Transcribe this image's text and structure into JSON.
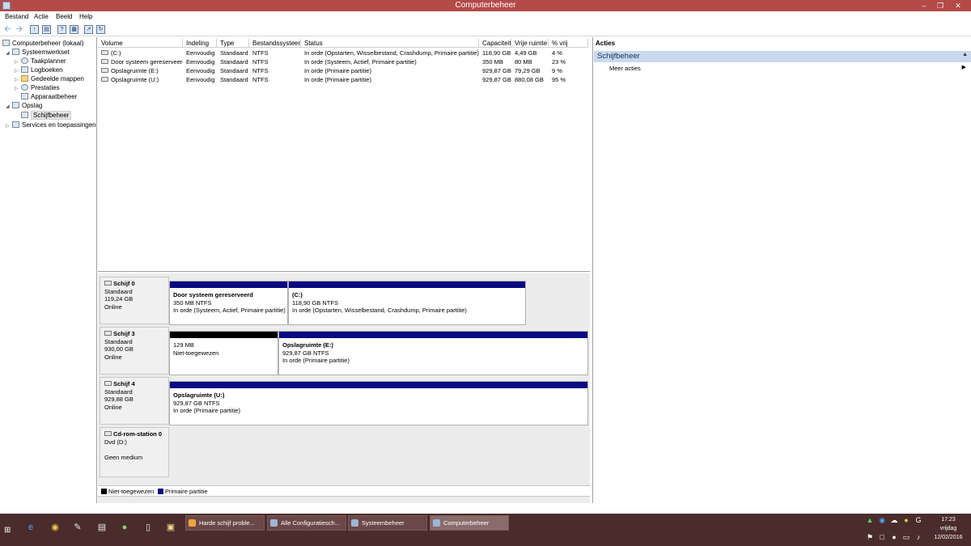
{
  "window": {
    "title": "Computerbeheer",
    "min_icon": "minimize-icon",
    "restore_icon": "restore-icon",
    "close_icon": "close-icon"
  },
  "menu": [
    "Bestand",
    "Actie",
    "Beeld",
    "Help"
  ],
  "toolbar": {
    "icons": [
      "back-arrow-icon",
      "forward-arrow-icon",
      "up-folder-icon",
      "show-hide-tree-icon",
      "help-icon",
      "properties-icon",
      "export-icon",
      "refresh-icon"
    ]
  },
  "tree": [
    {
      "label": "Computerbeheer (lokaal)",
      "level": 0,
      "expanded": null,
      "icon": "computer-management-icon"
    },
    {
      "label": "Systeemwerkset",
      "level": 1,
      "expanded": true,
      "icon": "system-tools-icon"
    },
    {
      "label": "Taakplanner",
      "level": 2,
      "expanded": false,
      "icon": "task-scheduler-icon"
    },
    {
      "label": "Logboeken",
      "level": 2,
      "expanded": false,
      "icon": "event-viewer-icon"
    },
    {
      "label": "Gedeelde mappen",
      "level": 2,
      "expanded": false,
      "icon": "shared-folders-icon"
    },
    {
      "label": "Prestaties",
      "level": 2,
      "expanded": false,
      "icon": "performance-icon"
    },
    {
      "label": "Apparaatbeheer",
      "level": 2,
      "expanded": null,
      "icon": "device-manager-icon"
    },
    {
      "label": "Opslag",
      "level": 1,
      "expanded": true,
      "icon": "storage-icon"
    },
    {
      "label": "Schijfbeheer",
      "level": 2,
      "expanded": null,
      "icon": "disk-management-icon",
      "selected": true
    },
    {
      "label": "Services en toepassingen",
      "level": 1,
      "expanded": false,
      "icon": "services-icon"
    }
  ],
  "volumes": {
    "columns": [
      "Volume",
      "Indeling",
      "Type",
      "Bestandssysteem",
      "Status",
      "Capaciteit",
      "Vrije ruimte",
      "% vrij"
    ],
    "rows": [
      [
        "(C:)",
        "Eenvoudig",
        "Standaard",
        "NTFS",
        "In orde (Opstarten, Wisselbestand, Crashdump, Primaire partitie)",
        "118,90 GB",
        "4,49 GB",
        "4 %"
      ],
      [
        "Door systeem gereserveerd",
        "Eenvoudig",
        "Standaard",
        "NTFS",
        "In orde (Systeem, Actief, Primaire partitie)",
        "350 MB",
        "80 MB",
        "23 %"
      ],
      [
        "Opslagruimte (E:)",
        "Eenvoudig",
        "Standaard",
        "NTFS",
        "In orde (Primaire partitie)",
        "929,87 GB",
        "79,29 GB",
        "9 %"
      ],
      [
        "Opslagruimte (U:)",
        "Eenvoudig",
        "Standaard",
        "NTFS",
        "In orde (Primaire partitie)",
        "929,87 GB",
        "880,08 GB",
        "95 %"
      ]
    ]
  },
  "disks": [
    {
      "name": "Schijf 0",
      "type": "Standaard",
      "size": "119,24 GB",
      "state": "Online",
      "partitions": [
        {
          "title": "Door systeem gereserveerd",
          "size": "350 MB NTFS",
          "status": "In orde (Systeem, Actief, Primaire partitie)",
          "kind": "primary"
        },
        {
          "title": "(C:)",
          "size": "118,90 GB NTFS",
          "status": "In orde (Opstarten, Wisselbestand, Crashdump, Primaire partitie)",
          "kind": "primary"
        }
      ]
    },
    {
      "name": "Schijf 3",
      "type": "Standaard",
      "size": "930,00 GB",
      "state": "Online",
      "partitions": [
        {
          "title": "",
          "size": "129 MB",
          "status": "Niet-toegewezen",
          "kind": "unallocated"
        },
        {
          "title": "Opslagruimte  (E:)",
          "size": "929,87 GB NTFS",
          "status": "In orde (Primaire partitie)",
          "kind": "primary"
        }
      ]
    },
    {
      "name": "Schijf 4",
      "type": "Standaard",
      "size": "929,88 GB",
      "state": "Online",
      "partitions": [
        {
          "title": "Opslagruimte  (U:)",
          "size": "929,87 GB NTFS",
          "status": "In orde (Primaire partitie)",
          "kind": "primary"
        }
      ]
    },
    {
      "name": "Cd-rom-station 0",
      "type": "Dvd (D:)",
      "size": "",
      "state": "Geen medium",
      "partitions": []
    }
  ],
  "legend": [
    {
      "label": "Niet-toegewezen",
      "color": "#000000"
    },
    {
      "label": "Primaire partitie",
      "color": "#0a0a82"
    }
  ],
  "actions": {
    "title": "Acties",
    "section": "Schijfbeheer",
    "item": "Meer acties"
  },
  "taskbar": {
    "pinned": [
      "ie-icon",
      "chrome-icon",
      "paint-icon",
      "notepad-icon",
      "android-icon",
      "phone-icon",
      "folder-icon"
    ],
    "tasks": [
      {
        "label": "Harde schijf proble...",
        "active": false
      },
      {
        "label": "Alle Configuratiesch...",
        "active": false
      },
      {
        "label": "Systeembeheer",
        "active": false
      },
      {
        "label": "Computerbeheer",
        "active": true
      }
    ],
    "clock": {
      "time": "17:23",
      "day": "vrijdag",
      "date": "12/02/2016"
    }
  }
}
